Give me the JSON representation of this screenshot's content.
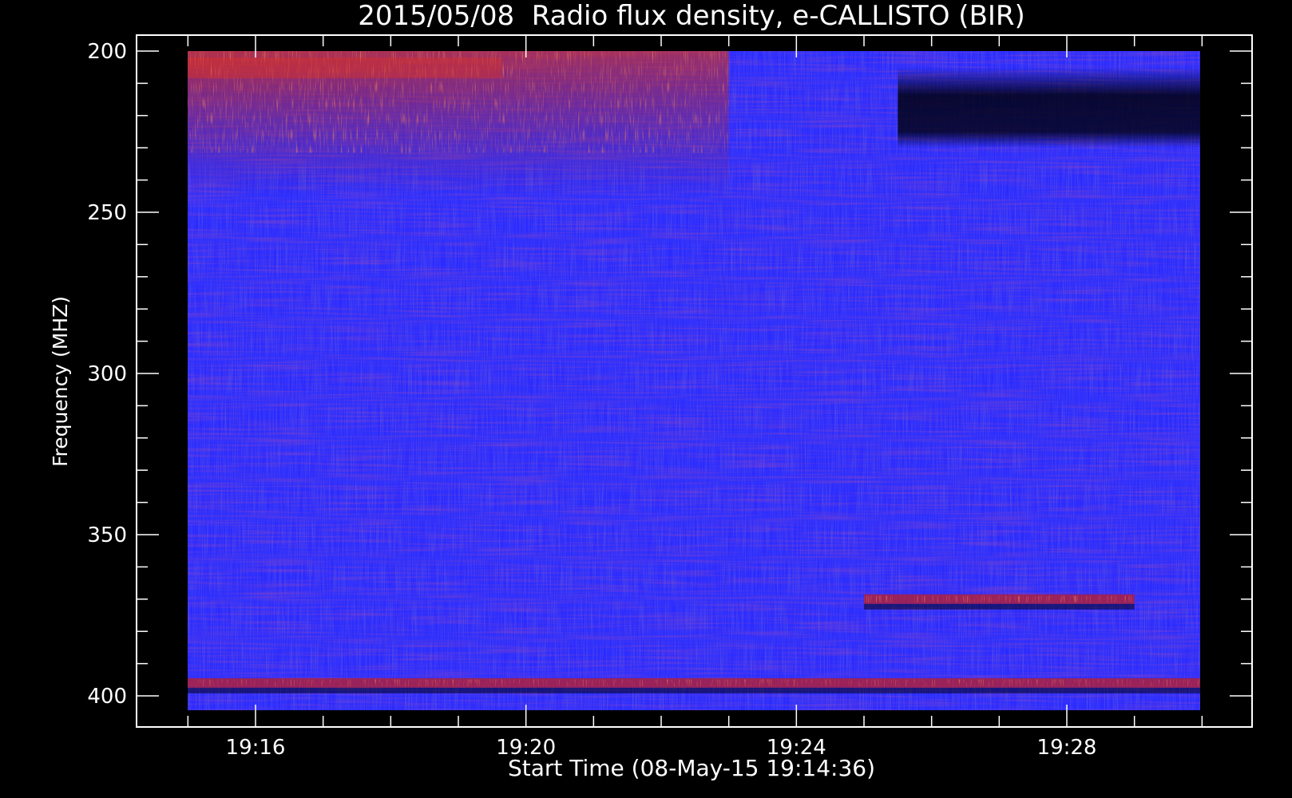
{
  "chart_data": {
    "type": "heatmap",
    "title": "2015/05/08  Radio flux density, e-CALLISTO (BIR)",
    "xlabel": "Start Time (08-May-15 19:14:36)",
    "ylabel": "Frequency (MHZ)",
    "x_range": [
      "19:14:36",
      "19:30:00"
    ],
    "y_range_mhz": [
      200,
      405
    ],
    "y_inverted": true,
    "x_ticks": [
      "19:16",
      "19:20",
      "19:24",
      "19:28"
    ],
    "y_ticks": [
      200,
      250,
      300,
      350,
      400
    ],
    "colormap": [
      "#000000",
      "#1a1ad6",
      "#2a2aff",
      "#aa2040",
      "#e03020",
      "#ffd040"
    ],
    "background_color": "#000000",
    "features": [
      {
        "type": "burst_band",
        "freq_mhz": [
          200,
          245
        ],
        "time": [
          "19:14:36",
          "19:23:00"
        ],
        "level": "high"
      },
      {
        "type": "emission_line",
        "freq_mhz": 370,
        "time": [
          "19:25:00",
          "19:29:00"
        ],
        "level": "medium"
      },
      {
        "type": "emission_line",
        "freq_mhz": 396,
        "time": [
          "19:14:36",
          "19:30:00"
        ],
        "level": "medium"
      },
      {
        "type": "quiet_region",
        "freq_mhz": [
          205,
          230
        ],
        "time": [
          "19:25:30",
          "19:30:00"
        ],
        "level": "low"
      }
    ]
  }
}
